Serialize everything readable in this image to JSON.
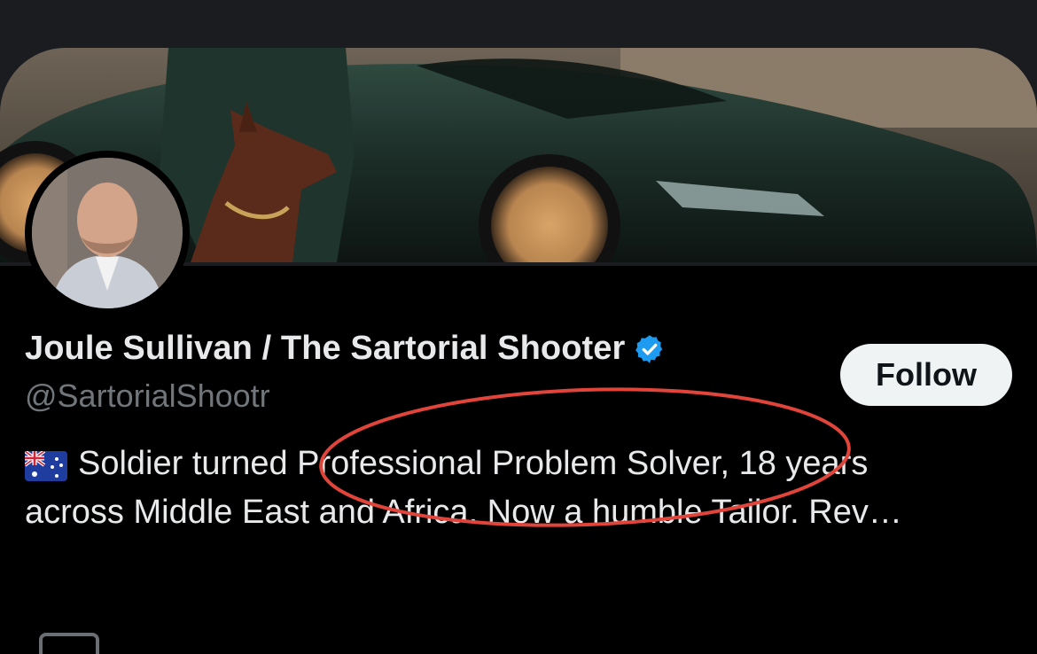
{
  "profile": {
    "display_name": "Joule Sullivan / The Sartorial Shooter",
    "handle": "@SartorialShootr",
    "verified": true,
    "follow_label": "Follow",
    "bio_line_1": "Soldier turned Professional Problem Solver, 18 years",
    "bio_line_2": "across Middle East and Africa. Now a humble Tailor. Rev…",
    "flag": "australia-flag"
  },
  "colors": {
    "background": "#000000",
    "verified_blue": "#1d9bf0",
    "annotation_red": "#e0443a",
    "handle_gray": "#71767b",
    "button_bg": "#eff3f4"
  },
  "annotation": {
    "shape": "ellipse",
    "color": "#e0443a",
    "encloses": "Professional Problem Solver, 18 years"
  }
}
